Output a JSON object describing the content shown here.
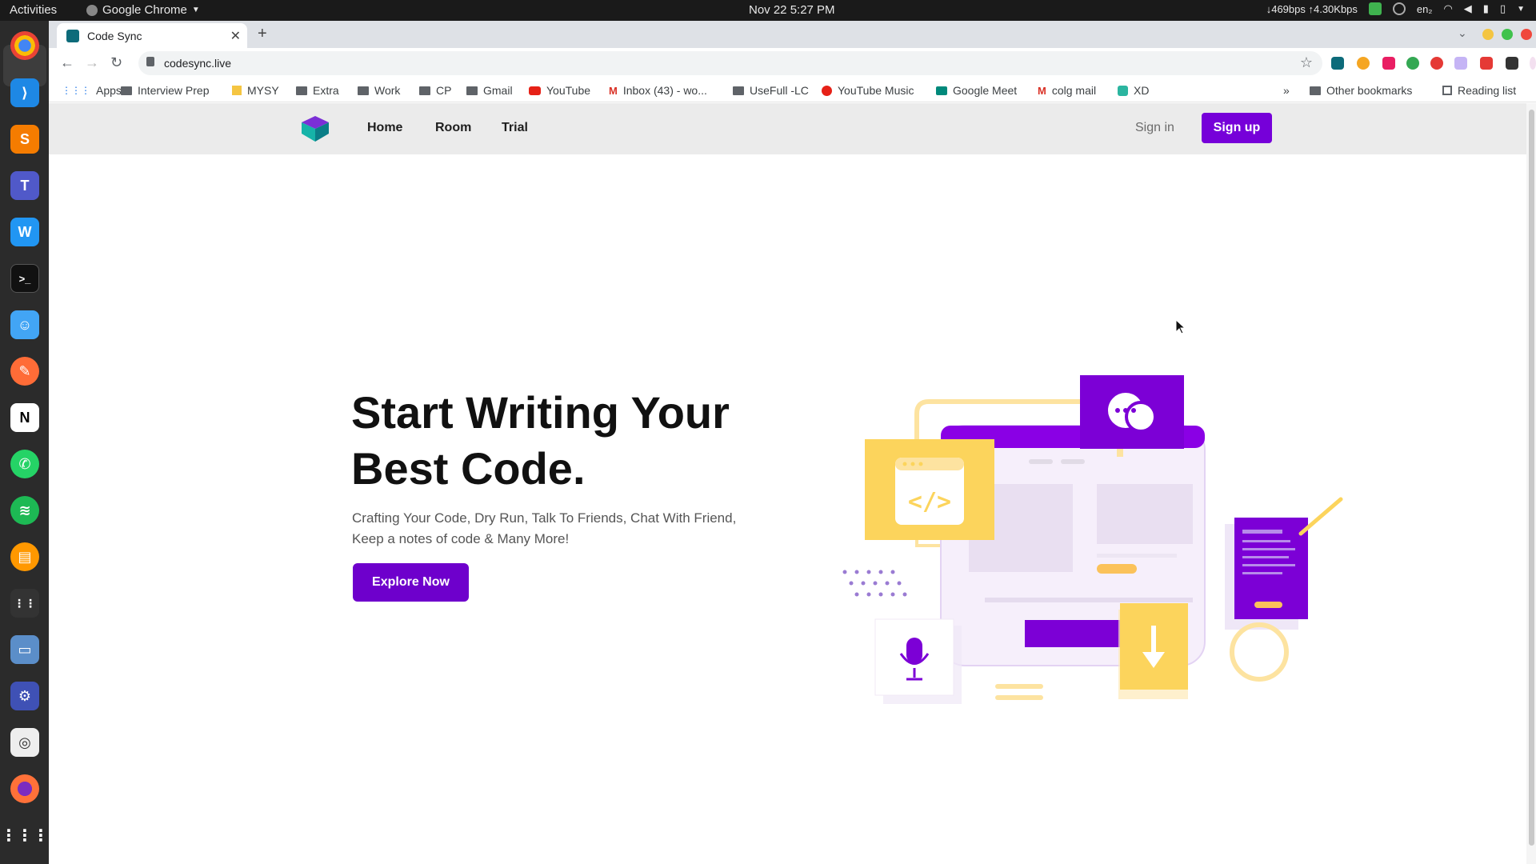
{
  "system": {
    "activities": "Activities",
    "app_name": "Google Chrome",
    "clock": "Nov 22  5:27 PM",
    "network": "↓469bps ↑4.30Kbps",
    "language": "en₂"
  },
  "browser": {
    "tab_title": "Code Sync",
    "url": "codesync.live",
    "bookmarks": [
      "Apps",
      "Interview Prep",
      "MYSY",
      "Extra",
      "Work",
      "CP",
      "Gmail",
      "YouTube",
      "Inbox (43) - wo...",
      "UseFull -LC",
      "YouTube Music",
      "Google Meet",
      "colg mail",
      "XD"
    ],
    "overflow": "»",
    "other_bookmarks": "Other bookmarks",
    "reading_list": "Reading list"
  },
  "site": {
    "nav": {
      "home": "Home",
      "room": "Room",
      "trial": "Trial"
    },
    "sign_in": "Sign in",
    "sign_up": "Sign up",
    "hero": {
      "title_line1": "Start Writing Your",
      "title_line2": "Best Code.",
      "subtitle_line1": "Crafting Your Code, Dry Run, Talk To Friends, Chat With Friend,",
      "subtitle_line2": "Keep a notes of code & Many More!",
      "cta": "Explore Now"
    }
  },
  "colors": {
    "brand_purple": "#7600d9",
    "accent_yellow": "#fbd45a",
    "nav_bg": "#ebebeb"
  },
  "icons": {
    "illustration_code": "code-brackets-icon",
    "illustration_chat": "chat-bubbles-icon",
    "illustration_notes": "document-icon",
    "illustration_mic": "microphone-icon",
    "illustration_download": "download-arrow-icon"
  }
}
